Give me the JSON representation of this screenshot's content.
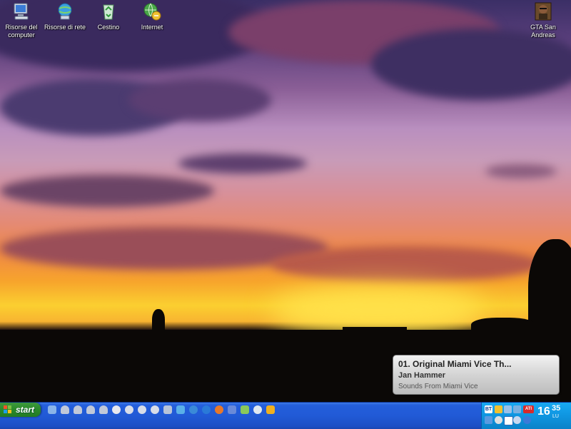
{
  "desktop": {
    "icons": [
      {
        "label": "Risorse del computer",
        "icon": "my-computer-icon"
      },
      {
        "label": "Risorse di rete",
        "icon": "network-places-icon"
      },
      {
        "label": "Cestino",
        "icon": "recycle-bin-icon"
      },
      {
        "label": "Internet",
        "icon": "internet-icon"
      },
      {
        "label": "GTA San Andreas",
        "icon": "gta-san-andreas-icon"
      }
    ]
  },
  "notification": {
    "track": "01. Original Miami Vice Th...",
    "artist": "Jan Hammer",
    "album": "Sounds From Miami Vice"
  },
  "taskbar": {
    "start_label": "start",
    "quicklaunch_count": 17,
    "tray": {
      "bt_label": "BT",
      "ati_label": "ATI",
      "clock_hour": "16",
      "clock_minute": "35",
      "clock_day": "LU"
    }
  },
  "colors": {
    "taskbar_blue": "#245edb",
    "start_green": "#2a8a2a",
    "tray_blue": "#0f95e0"
  }
}
